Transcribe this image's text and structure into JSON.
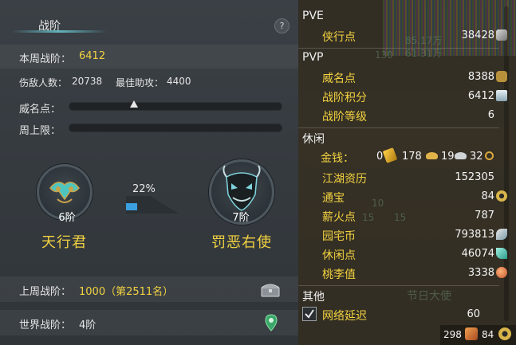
{
  "left": {
    "title": "战阶",
    "help": "?",
    "weekly_label": "本周战阶：",
    "weekly_value": "6412",
    "kills_label": "伤敌人数：",
    "kills_value": "20738",
    "assist_label": "最佳助攻：",
    "assist_value": "4400",
    "fame_label": "威名点：",
    "weekly_cap_label": "周上限：",
    "current_tier": "6阶",
    "current_title": "天行君",
    "progress_percent": "22%",
    "progress_fraction": 0.22,
    "next_tier": "7阶",
    "next_title": "罚恶右使",
    "last_week_label": "上周战阶：",
    "last_week_value": "1000（第2511名）",
    "world_label": "世界战阶：",
    "world_value": "4阶"
  },
  "right": {
    "pve_header": "PVE",
    "pve_items": [
      {
        "label": "侠行点",
        "value": "38428",
        "icon": "sword-icon"
      }
    ],
    "pvp_header": "PVP",
    "pvp_items": [
      {
        "label": "威名点",
        "value": "8388",
        "icon": "mask-icon"
      },
      {
        "label": "战阶积分",
        "value": "6412",
        "icon": "crystal-icon"
      },
      {
        "label": "战阶等级",
        "value": "6",
        "icon": ""
      }
    ],
    "leisure_header": "休闲",
    "money_label": "金钱：",
    "money_gold": "0",
    "money_silver_big": "178",
    "money_silver": "19",
    "money_copper": "32",
    "leisure_items": [
      {
        "label": "江湖资历",
        "value": "152305",
        "icon": ""
      },
      {
        "label": "通宝",
        "value": "84",
        "icon": "coin-icon"
      },
      {
        "label": "薪火点",
        "value": "787",
        "icon": ""
      },
      {
        "label": "园宅币",
        "value": "793813",
        "icon": "feather-icon"
      },
      {
        "label": "休闲点",
        "value": "46074",
        "icon": "leaf-icon"
      },
      {
        "label": "桃李值",
        "value": "3338",
        "icon": "peach-icon"
      }
    ],
    "other_header": "其他",
    "latency_label": "网络延迟",
    "latency_value": "60",
    "footer_left": "298",
    "footer_right": "84",
    "bg_text": [
      "85.17万",
      "61.31万",
      "130",
      "10",
      "15",
      "15",
      "节日大使"
    ],
    "colors": {
      "accent": "#f2d240",
      "value": "#f4f4f4",
      "header": "#f0f0f0"
    }
  }
}
